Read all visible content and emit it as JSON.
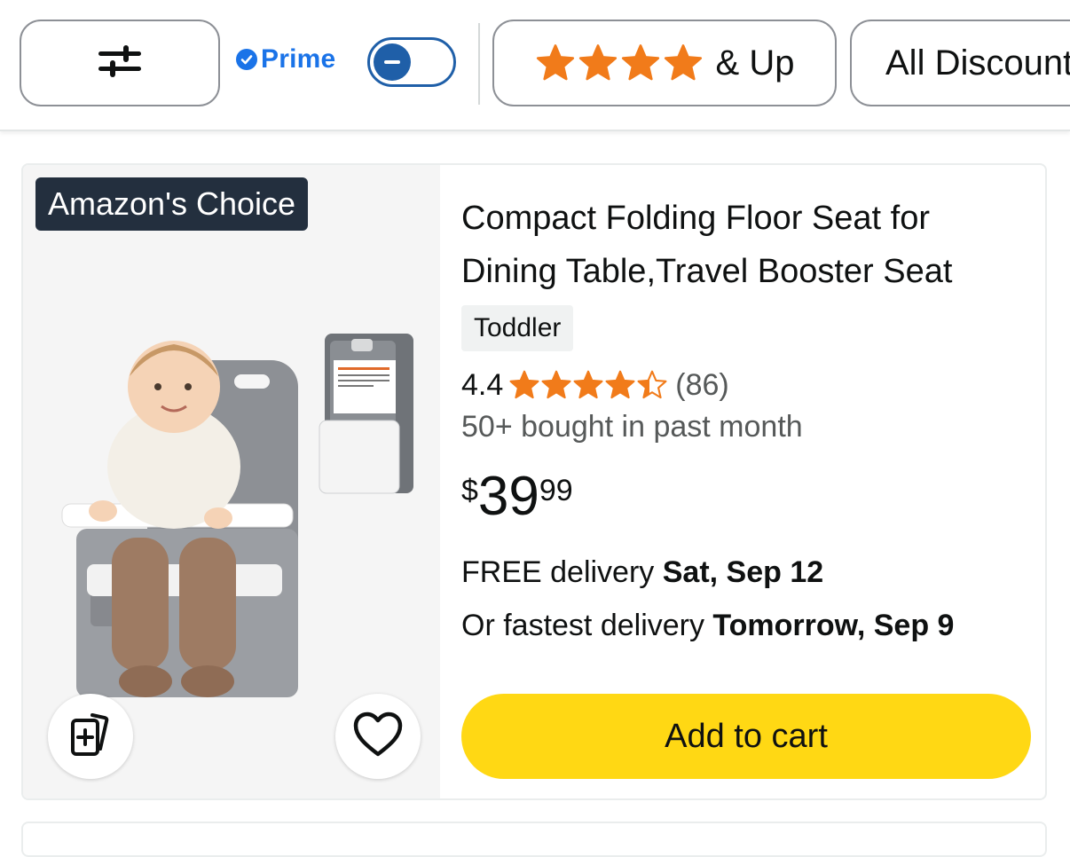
{
  "filter_bar": {
    "filters_icon": "sliders-icon",
    "prime_label": "Prime",
    "prime_toggle_on": false,
    "rating_filter_stars": 4,
    "rating_filter_label": "& Up",
    "discount_filter_label": "All Discounts"
  },
  "product": {
    "badge": "Amazon's Choice",
    "title": "Compact Folding Floor Seat for Dining Table,Travel Booster Seat",
    "variant": "Toddler",
    "rating": "4.4",
    "rating_value": 4.4,
    "review_count": "(86)",
    "bought_text": "50+ bought in past month",
    "price": {
      "symbol": "$",
      "whole": "39",
      "fraction": "99"
    },
    "delivery_prefix": "FREE delivery ",
    "delivery_date": "Sat, Sep 12",
    "fastest_prefix": "Or fastest delivery ",
    "fastest_date": "Tomorrow, Sep 9",
    "add_to_cart": "Add to cart",
    "compare_icon": "compare-icon",
    "wishlist_icon": "heart-icon"
  },
  "colors": {
    "star": "#f17b1a",
    "prime_blue": "#1a73e8",
    "toggle_blue": "#1f5fa8",
    "cart_yellow": "#ffd814",
    "badge_bg": "#232f3e"
  }
}
